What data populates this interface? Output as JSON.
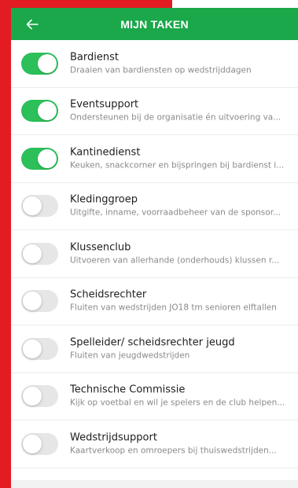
{
  "header": {
    "title": "MIJN TAKEN",
    "back_icon": "arrow-left-icon"
  },
  "colors": {
    "header_green": "#1aa84a",
    "toggle_on": "#2cbf5a",
    "toggle_off": "#e6e6e6",
    "side_red": "#e31b23"
  },
  "tasks": [
    {
      "title": "Bardienst",
      "subtitle": "Draaien van bardiensten op wedstrijddagen",
      "enabled": true
    },
    {
      "title": "Eventsupport",
      "subtitle": "Ondersteunen bij de organisatie én uitvoering va...",
      "enabled": true
    },
    {
      "title": "Kantinedienst",
      "subtitle": "Keuken, snackcorner en bijspringen bij bardienst i...",
      "enabled": true
    },
    {
      "title": "Kledinggroep",
      "subtitle": "Uitgifte, inname, voorraadbeheer van de sponsor...",
      "enabled": false
    },
    {
      "title": "Klussenclub",
      "subtitle": "Uitvoeren van allerhande (onderhouds) klussen r...",
      "enabled": false
    },
    {
      "title": "Scheidsrechter",
      "subtitle": "Fluiten van wedstrijden JO18 tm senioren elftallen",
      "enabled": false
    },
    {
      "title": "Spelleider/ scheidsrechter jeugd",
      "subtitle": "Fluiten van jeugdwedstrijden",
      "enabled": false
    },
    {
      "title": "Technische Commissie",
      "subtitle": "Kijk op voetbal en wil je spelers en de club helpen...",
      "enabled": false
    },
    {
      "title": "Wedstrijdsupport",
      "subtitle": "Kaartverkoop en omroepers bij thuiswedstrijden...",
      "enabled": false
    }
  ]
}
